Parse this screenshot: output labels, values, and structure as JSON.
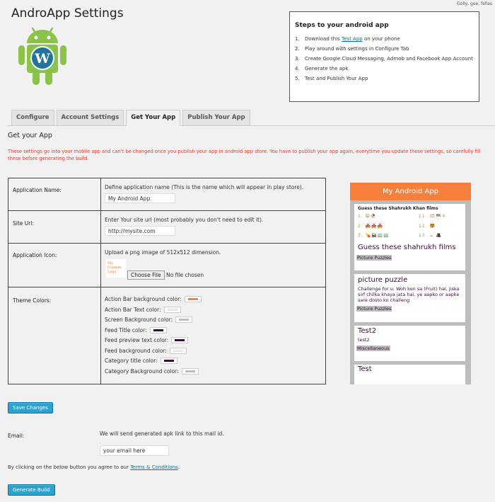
{
  "header": {
    "title": "AndroApp Settings",
    "top_quote": "Golly, gee, fellas"
  },
  "steps": {
    "title": "Steps to your android app",
    "items": [
      {
        "num": "1.",
        "before": "Download this ",
        "link": "Test App",
        "after": " on your phone"
      },
      {
        "num": "2.",
        "text": "Play around with settings in Configure Tab"
      },
      {
        "num": "3.",
        "text": "Create Google Cloud Messaging, Admob and Facebook App Account"
      },
      {
        "num": "4.",
        "text": "Generate the apk"
      },
      {
        "num": "5.",
        "text": "Test and Publish Your App"
      }
    ]
  },
  "tabs": [
    {
      "label": "Configure",
      "active": false
    },
    {
      "label": "Account Settings",
      "active": false
    },
    {
      "label": "Get Your App",
      "active": true
    },
    {
      "label": "Publish Your App",
      "active": false
    }
  ],
  "main": {
    "section_title": "Get your App",
    "warning": "These settings go into your mobile app and can't be changed once you publish your app in android app store. You have to publish your app again, everytime you update these settings, so carefully fill these before generating the build.",
    "app_name": {
      "label": "Application Name:",
      "desc": "Define application name (This is the name which will appear in play store).",
      "value": "My Android App"
    },
    "site_url": {
      "label": "Site Url:",
      "desc": "Enter Your site url (most probably you don't need to edit it).",
      "value": "http://mysite.com"
    },
    "app_icon": {
      "label": "Application Icon:",
      "desc": "Upload a png image of 512x512 dimension.",
      "custom_logo_text": "My Custom Logo",
      "file_button": "Choose File",
      "file_status": "No file chosen"
    },
    "theme": {
      "label": "Theme Colors:",
      "colors": [
        {
          "label": "Action Bar background color:",
          "color": "#f77f3b"
        },
        {
          "label": "Action Bar Text color:",
          "color": "#ffffff"
        },
        {
          "label": "Screen Background color:",
          "color": "#bdbdbd"
        },
        {
          "label": "Feed Title color:",
          "color": "#3e0a3e"
        },
        {
          "label": "Feed preview text color:",
          "color": "#3e0a3e"
        },
        {
          "label": "Feed background color:",
          "color": "#ffffff"
        },
        {
          "label": "Category title color:",
          "color": "#3e0a3e"
        },
        {
          "label": "Category Background color:",
          "color": "#bdbdbd"
        }
      ]
    },
    "save_button": "Save Changes",
    "email": {
      "label": "Email:",
      "desc": "We will send generated apk link to this mail id.",
      "placeholder": "your email here"
    },
    "terms": {
      "before": "By clicking on the below button you agree to our ",
      "link": "Terms & Conditions",
      "after": "."
    },
    "generate_button": "Generate Build"
  },
  "preview": {
    "action_bar_title": "My Android App",
    "thumb_heading": "Guess these Shahrukh Khan films",
    "cards": [
      {
        "title": "Guess these shahrukh films",
        "category": "Picture Puzzles"
      },
      {
        "title": "picture puzzle",
        "preview": "Challenge for u: Woh kon sa (Fruit) hai, jiska sirf chilka khaya jata hai. ye aapko or aapke sare dosto ko challeng",
        "category": "Picture Puzzles"
      },
      {
        "title": "Test2",
        "preview": "test2",
        "category": "Miscellaneous"
      },
      {
        "title": "Test"
      }
    ]
  }
}
